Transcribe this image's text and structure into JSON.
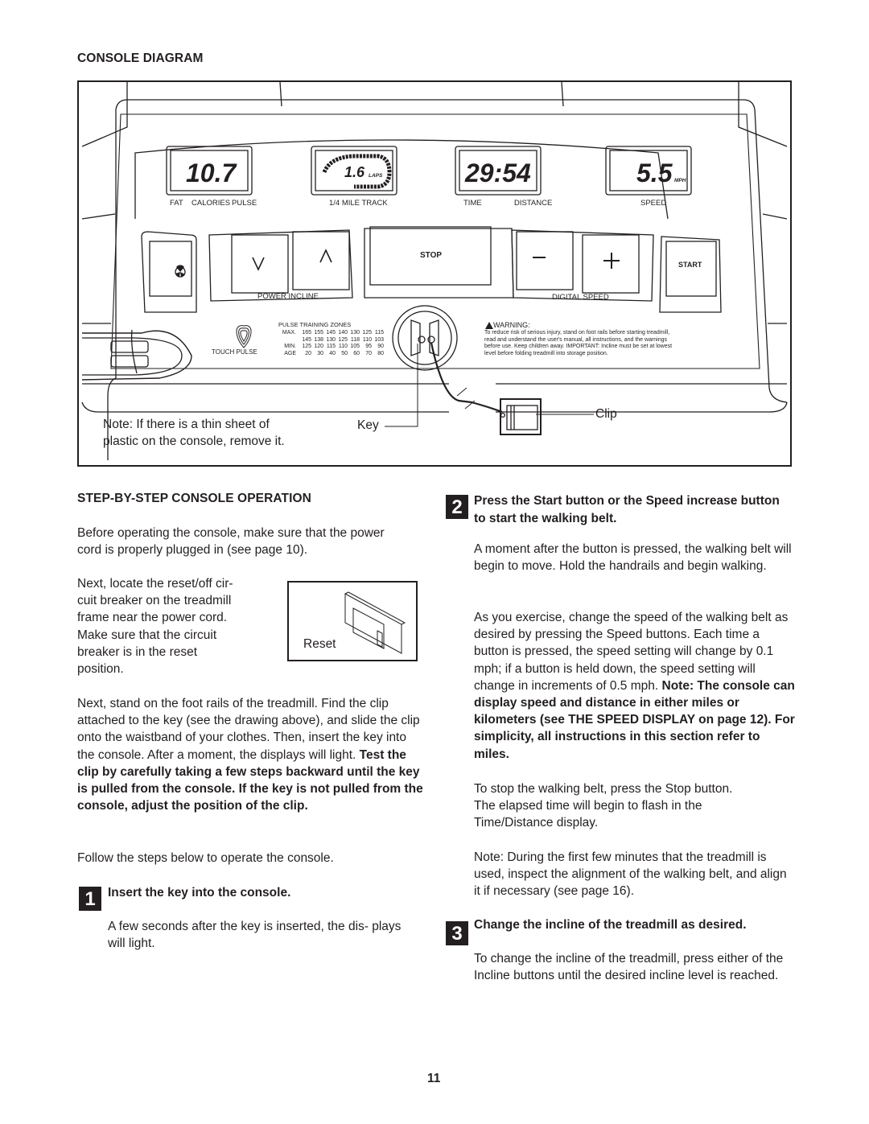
{
  "page": {
    "number": "11",
    "heading": "CONSOLE DIAGRAM"
  },
  "console": {
    "displays": [
      {
        "value": "10.7",
        "labels": [
          "FAT",
          "CALORIES",
          "PULSE"
        ]
      },
      {
        "value": "1.6",
        "unit": "LAPS",
        "labels": [
          "1/4 MILE TRACK"
        ]
      },
      {
        "value": "29:54",
        "labels": [
          "TIME",
          "DISTANCE"
        ]
      },
      {
        "value": "5.5",
        "unit": "MPH",
        "labels": [
          "SPEED"
        ]
      }
    ],
    "buttons": {
      "fan_icon": "fan-icon",
      "incline_down": "∨",
      "incline_up": "∧",
      "incline_group_label": "POWER INCLINE",
      "stop": "STOP",
      "speed_down": "−",
      "speed_up": "+",
      "speed_group_label": "DIGITAL SPEED",
      "start": "START"
    },
    "touch_pulse_label": "TOUCH PULSE",
    "pulse_zones": {
      "title": "PULSE TRAINING ZONES",
      "rows": [
        {
          "label": "MAX.",
          "values": [
            "165",
            "155",
            "145",
            "140",
            "130",
            "125",
            "115"
          ]
        },
        {
          "label": "",
          "values": [
            "145",
            "138",
            "130",
            "125",
            "118",
            "110",
            "103"
          ]
        },
        {
          "label": "MIN.",
          "values": [
            "125",
            "120",
            "115",
            "110",
            "105",
            "95",
            "90"
          ]
        },
        {
          "label": "AGE",
          "values": [
            "20",
            "30",
            "40",
            "50",
            "60",
            "70",
            "80"
          ]
        }
      ]
    },
    "warning": {
      "title": "WARNING:",
      "lines": [
        "To reduce risk of serious injury, stand on foot rails before starting treadmill,",
        "read and understand the user's manual, all instructions, and the warnings",
        "before use.  Keep children away.  IMPORTANT: Incline must be set at lowest",
        "level before folding treadmill into storage position."
      ]
    },
    "callouts": {
      "key": "Key",
      "clip": "Clip",
      "note_line1": "Note: If there is a thin sheet of",
      "note_line2": "plastic on the console, remove it."
    }
  },
  "operation": {
    "heading": "STEP-BY-STEP CONSOLE OPERATION",
    "intro": "Before operating the console, make sure that the power cord is properly plugged in (see page 10).",
    "breaker_lines": [
      "Next, locate the reset/off cir-",
      "cuit breaker on the treadmill",
      "frame near the power cord.",
      "Make sure that the circuit",
      "breaker is in the reset",
      "position."
    ],
    "reset_label": "Reset",
    "clip_para_normal": "Next, stand on the foot rails of the treadmill. Find the clip attached to the key (see the drawing above), and slide the clip onto the waistband of your clothes. Then, insert the key into the console. After a moment, the displays will light. ",
    "clip_para_bold": "Test the clip by carefully taking a few steps backward until the key is pulled from the console. If the key is not pulled from the console, adjust the position of the clip.",
    "follow": "Follow the steps below to operate the console.",
    "steps": [
      {
        "num": "1",
        "title": "Insert the key into the console.",
        "paras": [
          "A few seconds after the key is inserted, the dis- plays will light."
        ]
      },
      {
        "num": "2",
        "title": "Press the Start button or the Speed increase button to start the walking belt.",
        "paras": [
          "A moment after the button is pressed, the walking belt will begin to move. Hold the handrails and begin walking."
        ],
        "speed_para_normal": "As you exercise, change the speed of the walking belt as desired by pressing the Speed buttons. Each time a button is pressed, the speed setting will change by 0.1 mph; if a button is held down, the speed setting will change in increments of 0.5 mph. ",
        "speed_para_bold": "Note: The console can display speed and distance in either miles or kilometers (see THE SPEED DISPLAY on page 12). For simplicity, all instructions in this section refer to miles.",
        "stop_para": "To stop the walking belt, press the Stop button. The elapsed time will begin to flash in the Time/Distance display.",
        "note_para": "Note: During the first few minutes that the treadmill is used, inspect the alignment of the walking belt, and align it if necessary (see page 16)."
      },
      {
        "num": "3",
        "title": "Change the incline of the treadmill as desired.",
        "paras": [
          "To change the incline of the treadmill, press either of the Incline buttons until the desired incline level is reached."
        ]
      }
    ]
  }
}
